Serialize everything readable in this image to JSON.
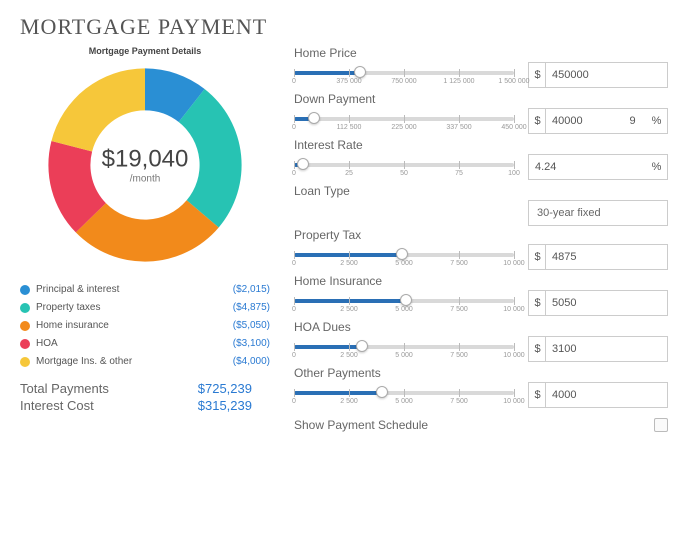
{
  "title": "MORTGAGE PAYMENT",
  "chart_title": "Mortgage Payment Details",
  "center": {
    "amount": "$19,040",
    "permonth": "/month"
  },
  "legend": [
    {
      "label": "Principal & interest",
      "value": "($2,015)",
      "color": "#2a8fd4"
    },
    {
      "label": "Property taxes",
      "value": "($4,875)",
      "color": "#27c3b3"
    },
    {
      "label": "Home insurance",
      "value": "($5,050)",
      "color": "#f28a1b"
    },
    {
      "label": "HOA",
      "value": "($3,100)",
      "color": "#eb3e58"
    },
    {
      "label": "Mortgage Ins. & other",
      "value": "($4,000)",
      "color": "#f6c73a"
    }
  ],
  "totals": [
    {
      "label": "Total Payments",
      "value": "$725,239"
    },
    {
      "label": "Interest Cost",
      "value": "$315,239"
    }
  ],
  "fields": {
    "home_price": {
      "label": "Home Price",
      "value": "450000",
      "prefix": "$",
      "pct": 30,
      "ticks": [
        "0",
        "375 000",
        "750 000",
        "1 125 000",
        "1 500 000"
      ]
    },
    "down_payment": {
      "label": "Down Payment",
      "value": "40000",
      "prefix": "$",
      "short": "9",
      "suffix": "%",
      "pct": 9,
      "ticks": [
        "0",
        "112 500",
        "225 000",
        "337 500",
        "450 000"
      ]
    },
    "interest_rate": {
      "label": "Interest Rate",
      "value": "4.24",
      "suffix_only": "%",
      "pct": 4,
      "ticks": [
        "0",
        "25",
        "50",
        "75",
        "100"
      ]
    },
    "loan_type": {
      "label": "Loan Type",
      "select": "30-year fixed"
    },
    "property_tax": {
      "label": "Property Tax",
      "value": "4875",
      "prefix": "$",
      "pct": 49,
      "ticks": [
        "0",
        "2 500",
        "5 000",
        "7 500",
        "10 000"
      ]
    },
    "home_ins": {
      "label": "Home Insurance",
      "value": "5050",
      "prefix": "$",
      "pct": 51,
      "ticks": [
        "0",
        "2 500",
        "5 000",
        "7 500",
        "10 000"
      ]
    },
    "hoa": {
      "label": "HOA Dues",
      "value": "3100",
      "prefix": "$",
      "pct": 31,
      "ticks": [
        "0",
        "2 500",
        "5 000",
        "7 500",
        "10 000"
      ]
    },
    "other": {
      "label": "Other Payments",
      "value": "4000",
      "prefix": "$",
      "pct": 40,
      "ticks": [
        "0",
        "2 500",
        "5 000",
        "7 500",
        "10 000"
      ]
    }
  },
  "show_payment_schedule": "Show Payment Schedule",
  "chart_data": {
    "type": "pie",
    "title": "Mortgage Payment Details",
    "center_value": 19040,
    "center_unit": "/month",
    "series": [
      {
        "name": "Principal & interest",
        "value": 2015,
        "color": "#2a8fd4"
      },
      {
        "name": "Property taxes",
        "value": 4875,
        "color": "#27c3b3"
      },
      {
        "name": "Home insurance",
        "value": 5050,
        "color": "#f28a1b"
      },
      {
        "name": "HOA",
        "value": 3100,
        "color": "#eb3e58"
      },
      {
        "name": "Mortgage Ins. & other",
        "value": 4000,
        "color": "#f6c73a"
      }
    ]
  }
}
